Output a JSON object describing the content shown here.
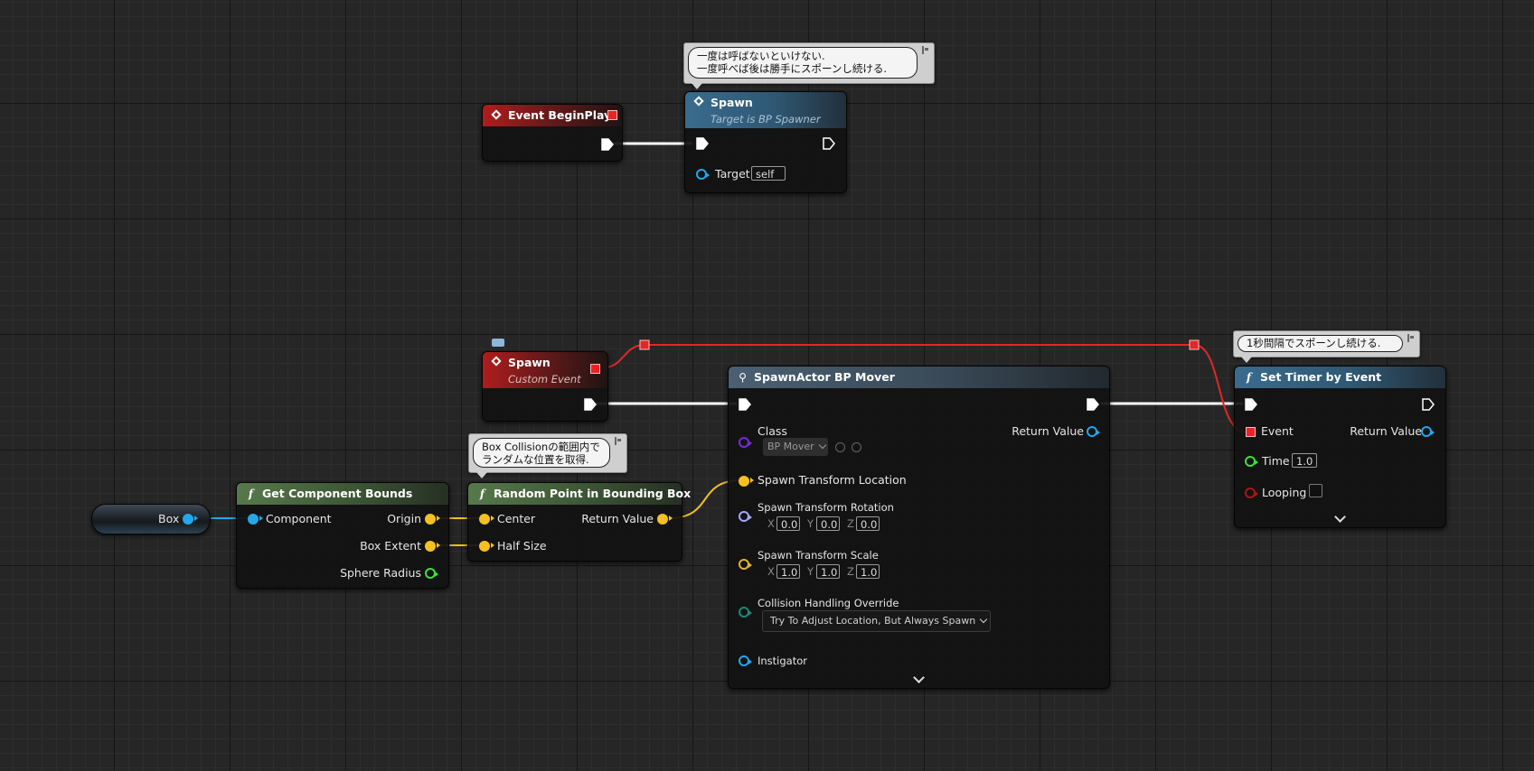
{
  "nodes": {
    "begin_play": {
      "title": "Event BeginPlay"
    },
    "spawn_call": {
      "title": "Spawn",
      "subtitle": "Target is BP Spawner",
      "target_label": "Target",
      "target_value": "self"
    },
    "spawn_event": {
      "title": "Spawn",
      "subtitle": "Custom Event"
    },
    "spawn_actor": {
      "title": "SpawnActor BP Mover",
      "class_label": "Class",
      "class_value": "BP Mover",
      "return_label": "Return Value",
      "location_label": "Spawn Transform Location",
      "rotation_label": "Spawn Transform Rotation",
      "rotation": {
        "x": "0.0",
        "y": "0.0",
        "z": "0.0"
      },
      "scale_label": "Spawn Transform Scale",
      "scale": {
        "x": "1.0",
        "y": "1.0",
        "z": "1.0"
      },
      "axis": {
        "x": "X",
        "y": "Y",
        "z": "Z"
      },
      "collision_label": "Collision Handling Override",
      "collision_value": "Try To Adjust Location, But Always Spawn",
      "instigator_label": "Instigator"
    },
    "set_timer": {
      "title": "Set Timer by Event",
      "event_label": "Event",
      "return_label": "Return Value",
      "time_label": "Time",
      "time_value": "1.0",
      "looping_label": "Looping"
    },
    "box_var": {
      "label": "Box"
    },
    "get_bounds": {
      "title": "Get Component Bounds",
      "component_label": "Component",
      "origin_label": "Origin",
      "box_extent_label": "Box Extent",
      "sphere_radius_label": "Sphere Radius"
    },
    "random_point": {
      "title": "Random Point in Bounding Box",
      "center_label": "Center",
      "half_size_label": "Half Size",
      "return_label": "Return Value"
    }
  },
  "comments": {
    "spawn_call": {
      "line1": "一度は呼ばないといけない.",
      "line2": "一度呼べば後は勝手にスポーンし続ける."
    },
    "set_timer": {
      "line1": "1秒間隔でスポーンし続ける."
    },
    "random_point": {
      "line1": "Box Collisionの範囲内で",
      "line2": "ランダムな位置を取得."
    }
  },
  "colors": {
    "exec_wire": "#ffffff",
    "delegate_wire": "#e02828",
    "object_pin": "#22a8ec",
    "vector_pin": "#f5c020",
    "float_pin": "#3ee03e",
    "class_pin": "#7a2bd8",
    "bool_pin": "#aa1616"
  }
}
